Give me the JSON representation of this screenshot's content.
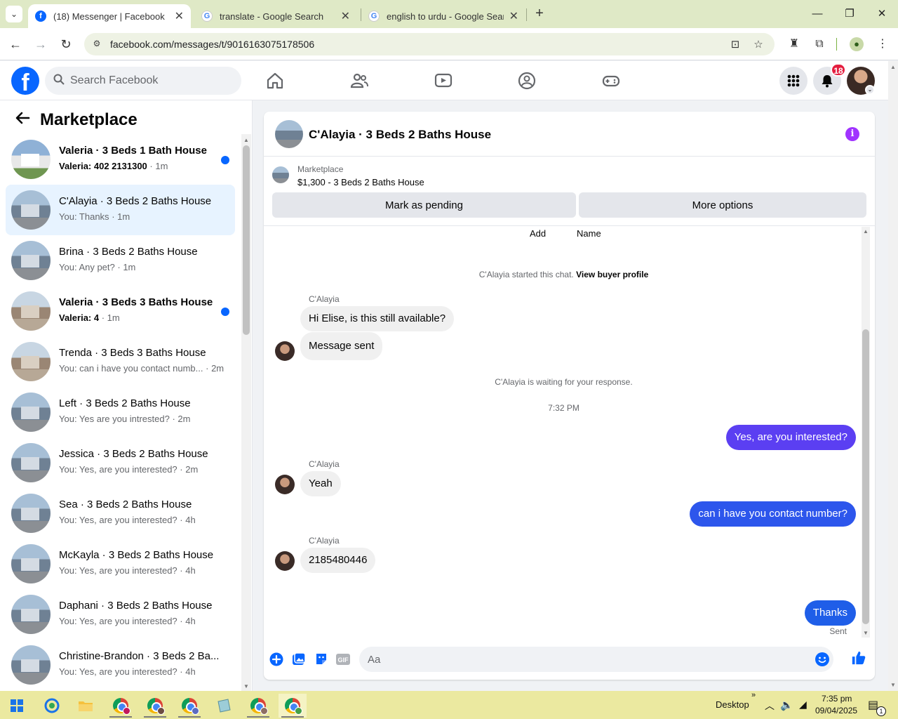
{
  "browser": {
    "tabs": [
      {
        "title": "(18) Messenger | Facebook",
        "active": true
      },
      {
        "title": "translate - Google Search",
        "active": false
      },
      {
        "title": "english to urdu - Google Search",
        "active": false
      }
    ],
    "url": "facebook.com/messages/t/9016163075178506"
  },
  "fb": {
    "search_placeholder": "Search Facebook",
    "notification_count": "18"
  },
  "sidebar": {
    "title": "Marketplace",
    "conversations": [
      {
        "name": "Valeria · 3 Beds 1 Bath House",
        "preview": "Valeria: 402 2131300",
        "time": "· 1m",
        "unread": true,
        "active": false
      },
      {
        "name": "C'Alayia · 3 Beds 2 Baths House",
        "preview": "You: Thanks",
        "time": "· 1m",
        "unread": false,
        "active": true
      },
      {
        "name": "Brina · 3 Beds 2 Baths House",
        "preview": "You: Any pet?",
        "time": "· 1m",
        "unread": false,
        "active": false
      },
      {
        "name": "Valeria · 3 Beds 3 Baths House",
        "preview": "Valeria: 4",
        "time": "· 1m",
        "unread": true,
        "active": false
      },
      {
        "name": "Trenda · 3 Beds 3 Baths House",
        "preview": "You: can i have you contact numb...",
        "time": "· 2m",
        "unread": false,
        "active": false
      },
      {
        "name": "Left · 3 Beds 2 Baths House",
        "preview": "You: Yes are you intrested?",
        "time": "· 2m",
        "unread": false,
        "active": false
      },
      {
        "name": "Jessica · 3 Beds 2 Baths House",
        "preview": "You: Yes, are you interested?",
        "time": "· 2m",
        "unread": false,
        "active": false
      },
      {
        "name": "Sea · 3 Beds 2 Baths House",
        "preview": "You: Yes, are you interested?",
        "time": "· 4h",
        "unread": false,
        "active": false
      },
      {
        "name": "McKayla · 3 Beds 2 Baths House",
        "preview": "You: Yes, are you interested?",
        "time": "· 4h",
        "unread": false,
        "active": false
      },
      {
        "name": "Daphani · 3 Beds 2 Baths House",
        "preview": "You: Yes, are you interested?",
        "time": "· 4h",
        "unread": false,
        "active": false
      },
      {
        "name": "Christine-Brandon · 3 Beds 2 Ba...",
        "preview": "You: Yes, are you interested?",
        "time": "· 4h",
        "unread": false,
        "active": false
      }
    ]
  },
  "chat": {
    "title": "C'Alayia · 3 Beds 2 Baths House",
    "listing_label": "Marketplace",
    "listing_price": "$1,300 - 3 Beds 2 Baths House",
    "mark_pending_label": "Mark as pending",
    "more_options_label": "More options",
    "add_label": "Add",
    "name_label": "Name",
    "started_note": "C'Alayia started this chat.",
    "buyer_profile_link": "View buyer profile",
    "sender_name": "C'Alayia",
    "msg_1": "Hi Elise, is this still available?",
    "msg_2": "Message sent",
    "waiting_note": "C'Alayia is waiting for your response.",
    "timestamp": "7:32 PM",
    "msg_3": "Yes, are you interested?",
    "msg_4": "Yeah",
    "msg_5": "can i have you contact number?",
    "msg_6": "2185480446",
    "msg_7": "Thanks",
    "sent_label": "Sent",
    "input_placeholder": "Aa",
    "accent_color": "#0866ff",
    "bubble_gradient_top": "#5b3ff2",
    "bubble_gradient_bottom": "#1f5ee8"
  },
  "taskbar": {
    "desktop_label": "Desktop",
    "time": "7:35 pm",
    "date": "09/04/2025",
    "notification_count": "1"
  }
}
